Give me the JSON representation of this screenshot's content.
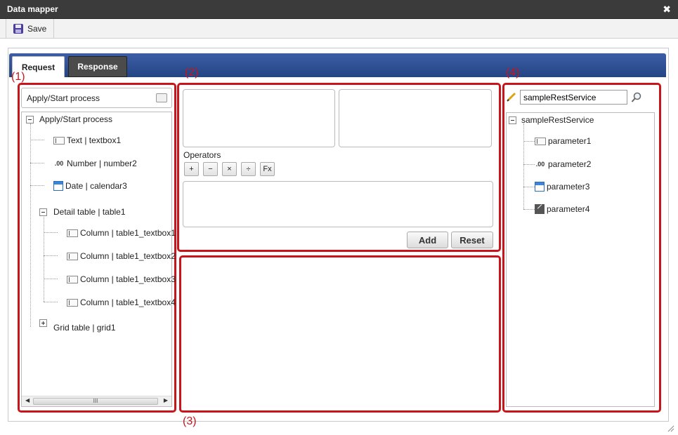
{
  "window": {
    "title": "Data mapper",
    "close_glyph": "✖"
  },
  "toolbar": {
    "save_label": "Save",
    "save_icon": "floppy-disk-icon"
  },
  "tabs": [
    {
      "label": "Request",
      "active": true
    },
    {
      "label": "Response",
      "active": false
    }
  ],
  "annotations": {
    "one": "(1)",
    "two": "(2)",
    "three": "(3)",
    "four": "(4)"
  },
  "source_panel": {
    "header_label": "Apply/Start process",
    "tree": {
      "root": "Apply/Start process",
      "items": [
        {
          "label": "Text | textbox1",
          "icon": "text-field-icon"
        },
        {
          "label": "Number | number2",
          "icon": "number-icon"
        },
        {
          "label": "Date | calendar3",
          "icon": "calendar-icon"
        },
        {
          "label": "Detail table | table1",
          "icon": "collapse-icon"
        },
        {
          "label": "Column | table1_textbox1",
          "icon": "text-field-icon"
        },
        {
          "label": "Column | table1_textbox2",
          "icon": "text-field-icon"
        },
        {
          "label": "Column | table1_textbox3",
          "icon": "text-field-icon"
        },
        {
          "label": "Column | table1_textbox4",
          "icon": "text-field-icon"
        },
        {
          "label": "Grid table | grid1",
          "icon": "expand-icon"
        }
      ]
    },
    "scroll_glyph": "III"
  },
  "expression_panel": {
    "operators_label": "Operators",
    "operators": [
      "+",
      "−",
      "×",
      "÷",
      "Fx"
    ],
    "add_label": "Add",
    "reset_label": "Reset"
  },
  "target_panel": {
    "search_value": "sampleRestService",
    "tree": {
      "root": "sampleRestService",
      "items": [
        {
          "label": "parameter1",
          "icon": "text-field-icon"
        },
        {
          "label": "parameter2",
          "icon": "number-icon"
        },
        {
          "label": "parameter3",
          "icon": "calendar-icon"
        },
        {
          "label": "parameter4",
          "icon": "file-icon"
        }
      ]
    }
  },
  "colors": {
    "annotation_red": "#c8151b",
    "tabbar_blue": "#2d4f94",
    "titlebar": "#3b3b3b"
  }
}
